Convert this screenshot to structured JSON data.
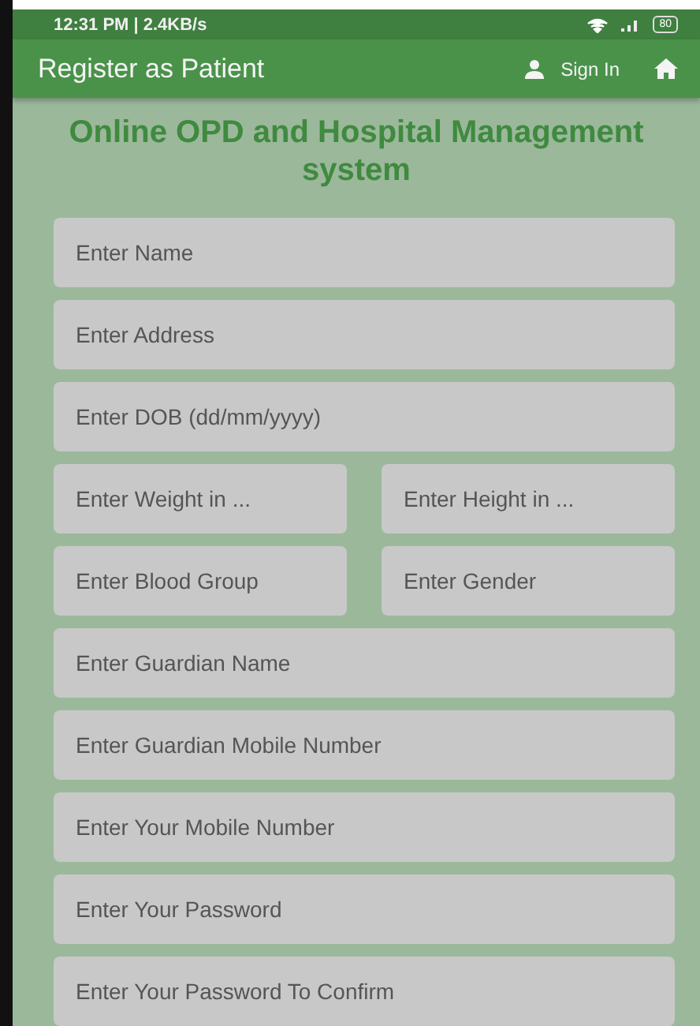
{
  "status_bar": {
    "time": "12:31 PM | 2.4KB/s",
    "battery": "80"
  },
  "app_bar": {
    "title": "Register as Patient",
    "sign_in": "Sign In"
  },
  "heading": "Online OPD and Hospital Management system",
  "form_rows": [
    {
      "fields": [
        {
          "placeholder": "Enter Name"
        }
      ]
    },
    {
      "fields": [
        {
          "placeholder": "Enter Address"
        }
      ]
    },
    {
      "fields": [
        {
          "placeholder": "Enter DOB (dd/mm/yyyy)"
        }
      ]
    },
    {
      "fields": [
        {
          "placeholder": "Enter Weight in ..."
        },
        {
          "placeholder": "Enter Height in ..."
        }
      ]
    },
    {
      "fields": [
        {
          "placeholder": "Enter Blood Group"
        },
        {
          "placeholder": "Enter Gender"
        }
      ]
    },
    {
      "fields": [
        {
          "placeholder": "Enter Guardian Name"
        }
      ]
    },
    {
      "fields": [
        {
          "placeholder": "Enter Guardian Mobile Number"
        }
      ]
    },
    {
      "fields": [
        {
          "placeholder": "Enter Your Mobile Number"
        }
      ]
    },
    {
      "fields": [
        {
          "placeholder": "Enter Your Password"
        }
      ]
    },
    {
      "fields": [
        {
          "placeholder": "Enter Your Password To Confirm"
        }
      ]
    }
  ]
}
